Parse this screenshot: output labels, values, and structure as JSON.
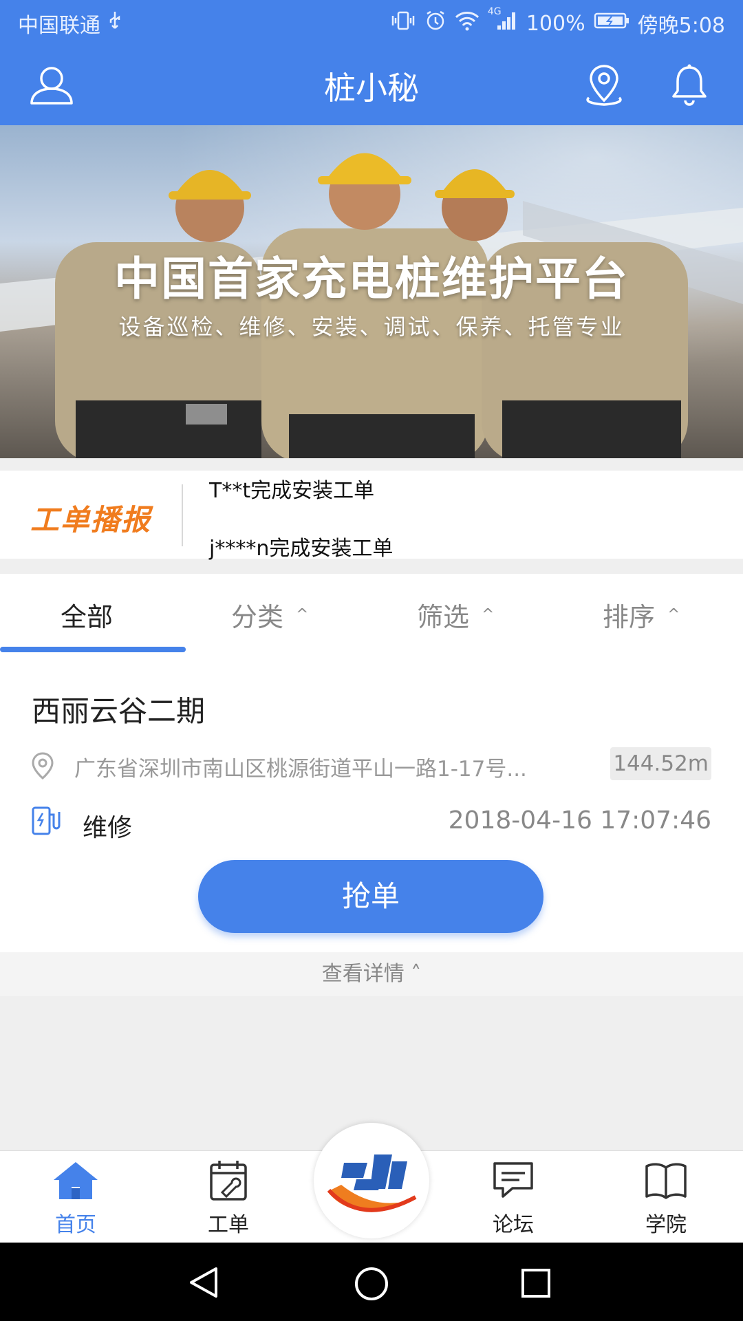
{
  "status_bar": {
    "carrier": "中国联通",
    "network": "4G",
    "battery": "100%",
    "time": "傍晚5:08"
  },
  "header": {
    "title": "桩小秘"
  },
  "banner": {
    "headline": "中国首家充电桩维护平台",
    "subline": "设备巡检、维修、安装、调试、保养、托管专业"
  },
  "ticker": {
    "brand": "工单播报",
    "lines": [
      "T**t完成安装工单",
      "j****n完成安装工单"
    ]
  },
  "tabs": [
    {
      "label": "全部",
      "active": true
    },
    {
      "label": "分类",
      "caret": "^"
    },
    {
      "label": "筛选",
      "caret": "^"
    },
    {
      "label": "排序",
      "caret": "^"
    }
  ],
  "order": {
    "name": "西丽云谷二期",
    "address": "广东省深圳市南山区桃源街道平山一路1-17号...",
    "distance": "144.52m",
    "type": "维修",
    "time": "2018-04-16 17:07:46",
    "grab_label": "抢单",
    "detail_label": "查看详情 ˄"
  },
  "bottom_nav": [
    {
      "label": "首页",
      "icon": "home-icon",
      "active": true
    },
    {
      "label": "工单",
      "icon": "work-order-icon"
    },
    {
      "label": "",
      "icon": "center-logo"
    },
    {
      "label": "论坛",
      "icon": "forum-icon"
    },
    {
      "label": "学院",
      "icon": "book-icon"
    }
  ],
  "colors": {
    "primary": "#4582ea",
    "brand_orange": "#f07c1e"
  }
}
